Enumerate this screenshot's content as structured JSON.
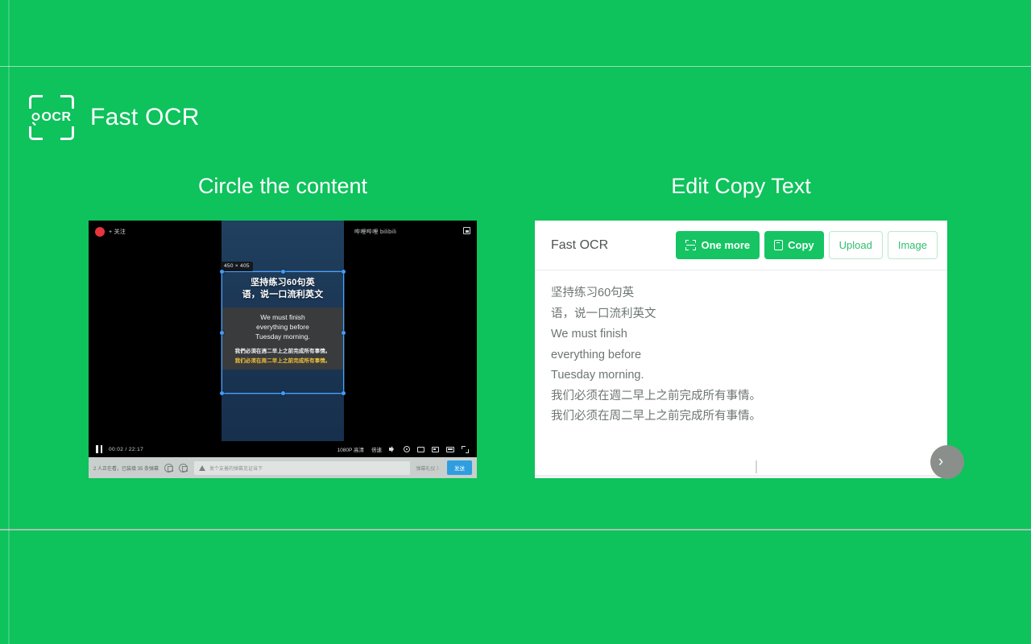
{
  "brand": {
    "name": "Fast OCR",
    "logo_icon": "ocr-scan-frame-icon",
    "logo_text": "OCR"
  },
  "headings": {
    "left": "Circle the content",
    "right": "Edit Copy Text"
  },
  "colors": {
    "background": "#0ec25c",
    "accent": "#16c464",
    "ghost_border": "#b9e9cd",
    "send_button": "#2f9ee0"
  },
  "player": {
    "follow_label": "+ 关注",
    "site_logo": "哔哩哔哩 bilibili",
    "selection_dimensions": "450 × 405",
    "subtitle_cn_title_line1": "坚持练习60句英",
    "subtitle_cn_title_line2": "语，说一口流利英文",
    "subtitle_en_line1": "We must finish",
    "subtitle_en_line2": "everything before",
    "subtitle_en_line3": "Tuesday morning.",
    "subtitle_cn_white": "我們必須在週二早上之前完成所有事情。",
    "subtitle_cn_yellow": "我们必须在周二早上之前完成所有事情。",
    "time": "00:02 / 22:17",
    "quality": "1080P 高清",
    "speed": "倍速",
    "danmaku_status": "2 人正在看，已装填 35 条弹幕",
    "danmaku_placeholder": "发个友善的弹幕见证当下",
    "gift_label": "弹幕礼仪 〉",
    "send_label": "发送"
  },
  "ocr": {
    "title": "Fast OCR",
    "buttons": [
      {
        "label": "One more",
        "icon": "scan-frame-icon",
        "style": "primary"
      },
      {
        "label": "Copy",
        "icon": "clipboard-icon",
        "style": "primary"
      },
      {
        "label": "Upload",
        "icon": "",
        "style": "ghost"
      },
      {
        "label": "Image",
        "icon": "",
        "style": "ghost"
      }
    ],
    "lines": [
      "坚持练习60句英",
      "语，说一口流利英文",
      "We must finish",
      "everything before",
      "Tuesday morning.",
      "我们必须在週二早上之前完成所有事情。",
      "我们必须在周二早上之前完成所有事情。"
    ],
    "next_label": "›"
  }
}
